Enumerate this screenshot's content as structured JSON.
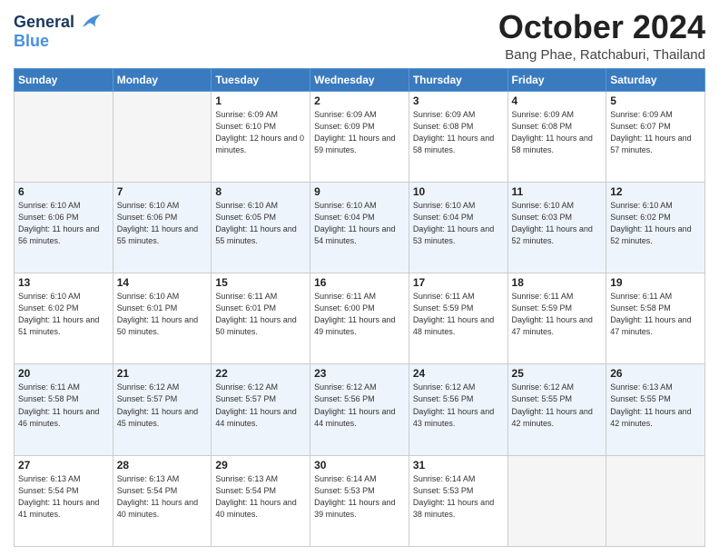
{
  "header": {
    "logo_line1": "General",
    "logo_line2": "Blue",
    "month_title": "October 2024",
    "location": "Bang Phae, Ratchaburi, Thailand"
  },
  "days_of_week": [
    "Sunday",
    "Monday",
    "Tuesday",
    "Wednesday",
    "Thursday",
    "Friday",
    "Saturday"
  ],
  "weeks": [
    {
      "cells": [
        {
          "day": "",
          "sunrise": "",
          "sunset": "",
          "daylight": ""
        },
        {
          "day": "",
          "sunrise": "",
          "sunset": "",
          "daylight": ""
        },
        {
          "day": "1",
          "sunrise": "Sunrise: 6:09 AM",
          "sunset": "Sunset: 6:10 PM",
          "daylight": "Daylight: 12 hours and 0 minutes."
        },
        {
          "day": "2",
          "sunrise": "Sunrise: 6:09 AM",
          "sunset": "Sunset: 6:09 PM",
          "daylight": "Daylight: 11 hours and 59 minutes."
        },
        {
          "day": "3",
          "sunrise": "Sunrise: 6:09 AM",
          "sunset": "Sunset: 6:08 PM",
          "daylight": "Daylight: 11 hours and 58 minutes."
        },
        {
          "day": "4",
          "sunrise": "Sunrise: 6:09 AM",
          "sunset": "Sunset: 6:08 PM",
          "daylight": "Daylight: 11 hours and 58 minutes."
        },
        {
          "day": "5",
          "sunrise": "Sunrise: 6:09 AM",
          "sunset": "Sunset: 6:07 PM",
          "daylight": "Daylight: 11 hours and 57 minutes."
        }
      ]
    },
    {
      "cells": [
        {
          "day": "6",
          "sunrise": "Sunrise: 6:10 AM",
          "sunset": "Sunset: 6:06 PM",
          "daylight": "Daylight: 11 hours and 56 minutes."
        },
        {
          "day": "7",
          "sunrise": "Sunrise: 6:10 AM",
          "sunset": "Sunset: 6:06 PM",
          "daylight": "Daylight: 11 hours and 55 minutes."
        },
        {
          "day": "8",
          "sunrise": "Sunrise: 6:10 AM",
          "sunset": "Sunset: 6:05 PM",
          "daylight": "Daylight: 11 hours and 55 minutes."
        },
        {
          "day": "9",
          "sunrise": "Sunrise: 6:10 AM",
          "sunset": "Sunset: 6:04 PM",
          "daylight": "Daylight: 11 hours and 54 minutes."
        },
        {
          "day": "10",
          "sunrise": "Sunrise: 6:10 AM",
          "sunset": "Sunset: 6:04 PM",
          "daylight": "Daylight: 11 hours and 53 minutes."
        },
        {
          "day": "11",
          "sunrise": "Sunrise: 6:10 AM",
          "sunset": "Sunset: 6:03 PM",
          "daylight": "Daylight: 11 hours and 52 minutes."
        },
        {
          "day": "12",
          "sunrise": "Sunrise: 6:10 AM",
          "sunset": "Sunset: 6:02 PM",
          "daylight": "Daylight: 11 hours and 52 minutes."
        }
      ]
    },
    {
      "cells": [
        {
          "day": "13",
          "sunrise": "Sunrise: 6:10 AM",
          "sunset": "Sunset: 6:02 PM",
          "daylight": "Daylight: 11 hours and 51 minutes."
        },
        {
          "day": "14",
          "sunrise": "Sunrise: 6:10 AM",
          "sunset": "Sunset: 6:01 PM",
          "daylight": "Daylight: 11 hours and 50 minutes."
        },
        {
          "day": "15",
          "sunrise": "Sunrise: 6:11 AM",
          "sunset": "Sunset: 6:01 PM",
          "daylight": "Daylight: 11 hours and 50 minutes."
        },
        {
          "day": "16",
          "sunrise": "Sunrise: 6:11 AM",
          "sunset": "Sunset: 6:00 PM",
          "daylight": "Daylight: 11 hours and 49 minutes."
        },
        {
          "day": "17",
          "sunrise": "Sunrise: 6:11 AM",
          "sunset": "Sunset: 5:59 PM",
          "daylight": "Daylight: 11 hours and 48 minutes."
        },
        {
          "day": "18",
          "sunrise": "Sunrise: 6:11 AM",
          "sunset": "Sunset: 5:59 PM",
          "daylight": "Daylight: 11 hours and 47 minutes."
        },
        {
          "day": "19",
          "sunrise": "Sunrise: 6:11 AM",
          "sunset": "Sunset: 5:58 PM",
          "daylight": "Daylight: 11 hours and 47 minutes."
        }
      ]
    },
    {
      "cells": [
        {
          "day": "20",
          "sunrise": "Sunrise: 6:11 AM",
          "sunset": "Sunset: 5:58 PM",
          "daylight": "Daylight: 11 hours and 46 minutes."
        },
        {
          "day": "21",
          "sunrise": "Sunrise: 6:12 AM",
          "sunset": "Sunset: 5:57 PM",
          "daylight": "Daylight: 11 hours and 45 minutes."
        },
        {
          "day": "22",
          "sunrise": "Sunrise: 6:12 AM",
          "sunset": "Sunset: 5:57 PM",
          "daylight": "Daylight: 11 hours and 44 minutes."
        },
        {
          "day": "23",
          "sunrise": "Sunrise: 6:12 AM",
          "sunset": "Sunset: 5:56 PM",
          "daylight": "Daylight: 11 hours and 44 minutes."
        },
        {
          "day": "24",
          "sunrise": "Sunrise: 6:12 AM",
          "sunset": "Sunset: 5:56 PM",
          "daylight": "Daylight: 11 hours and 43 minutes."
        },
        {
          "day": "25",
          "sunrise": "Sunrise: 6:12 AM",
          "sunset": "Sunset: 5:55 PM",
          "daylight": "Daylight: 11 hours and 42 minutes."
        },
        {
          "day": "26",
          "sunrise": "Sunrise: 6:13 AM",
          "sunset": "Sunset: 5:55 PM",
          "daylight": "Daylight: 11 hours and 42 minutes."
        }
      ]
    },
    {
      "cells": [
        {
          "day": "27",
          "sunrise": "Sunrise: 6:13 AM",
          "sunset": "Sunset: 5:54 PM",
          "daylight": "Daylight: 11 hours and 41 minutes."
        },
        {
          "day": "28",
          "sunrise": "Sunrise: 6:13 AM",
          "sunset": "Sunset: 5:54 PM",
          "daylight": "Daylight: 11 hours and 40 minutes."
        },
        {
          "day": "29",
          "sunrise": "Sunrise: 6:13 AM",
          "sunset": "Sunset: 5:54 PM",
          "daylight": "Daylight: 11 hours and 40 minutes."
        },
        {
          "day": "30",
          "sunrise": "Sunrise: 6:14 AM",
          "sunset": "Sunset: 5:53 PM",
          "daylight": "Daylight: 11 hours and 39 minutes."
        },
        {
          "day": "31",
          "sunrise": "Sunrise: 6:14 AM",
          "sunset": "Sunset: 5:53 PM",
          "daylight": "Daylight: 11 hours and 38 minutes."
        },
        {
          "day": "",
          "sunrise": "",
          "sunset": "",
          "daylight": ""
        },
        {
          "day": "",
          "sunrise": "",
          "sunset": "",
          "daylight": ""
        }
      ]
    }
  ]
}
